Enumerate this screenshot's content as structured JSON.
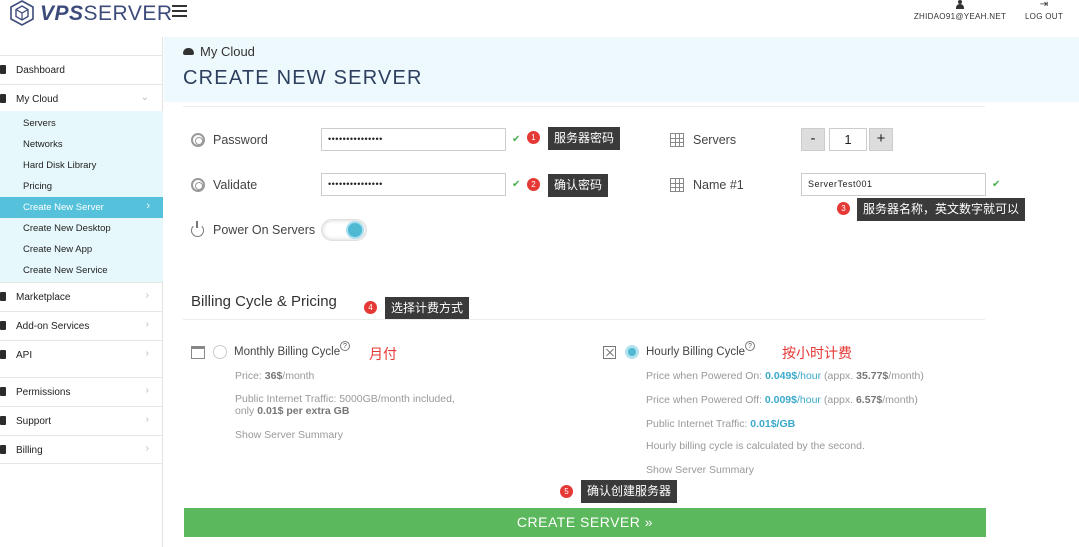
{
  "brand": {
    "logo_bold": "VPS",
    "logo_rest": "SERVER"
  },
  "header": {
    "user_email": "ZHIDAO91@YEAH.NET",
    "logout_label": "LOG OUT"
  },
  "sidebar": {
    "items": [
      {
        "label": "Dashboard"
      },
      {
        "label": "My Cloud"
      },
      {
        "label": "Marketplace"
      },
      {
        "label": "Add-on Services"
      },
      {
        "label": "API"
      },
      {
        "label": "Permissions"
      },
      {
        "label": "Support"
      },
      {
        "label": "Billing"
      }
    ],
    "sub_items": [
      {
        "label": "Servers"
      },
      {
        "label": "Networks"
      },
      {
        "label": "Hard Disk Library"
      },
      {
        "label": "Pricing"
      },
      {
        "label": "Create New Server"
      },
      {
        "label": "Create New Desktop"
      },
      {
        "label": "Create New App"
      },
      {
        "label": "Create New Service"
      }
    ]
  },
  "page": {
    "breadcrumb": "My Cloud",
    "title": "CREATE NEW SERVER"
  },
  "form": {
    "password_label": "Password",
    "password_value": "•••••••••••••••",
    "validate_label": "Validate",
    "validate_value": "•••••••••••••••",
    "servers_label": "Servers",
    "servers_count": "1",
    "minus_label": "-",
    "plus_label": "+",
    "name_label": "Name #1",
    "name_value": "ServerTest001",
    "power_label": "Power On Servers",
    "power_on": true
  },
  "annotations": [
    {
      "num": "1",
      "text": "服务器密码"
    },
    {
      "num": "2",
      "text": "确认密码"
    },
    {
      "num": "3",
      "text": "服务器名称，英文数字就可以"
    },
    {
      "num": "4",
      "text": "选择计费方式"
    },
    {
      "num": "5",
      "text": "确认创建服务器"
    }
  ],
  "notes": {
    "monthly": "月付",
    "hourly": "按小时计费"
  },
  "billing": {
    "section_title": "Billing Cycle & Pricing",
    "monthly": {
      "title": "Monthly Billing Cycle",
      "price_prefix": "Price: ",
      "price_value": "36$",
      "price_suffix": "/month",
      "traffic_line1": "Public Internet Traffic: 5000GB/month included,",
      "traffic_line2_prefix": "only ",
      "traffic_line2_bold": "0.01$ per extra GB",
      "summary_link": "Show Server Summary",
      "selected": false
    },
    "hourly": {
      "title": "Hourly Billing Cycle",
      "on_prefix": "Price when Powered On: ",
      "on_value": "0.049$",
      "on_unit": "/hour",
      "on_appx_prefix": " (appx. ",
      "on_appx_value": "35.77$",
      "on_appx_suffix": "/month)",
      "off_prefix": "Price when Powered Off: ",
      "off_value": "0.009$",
      "off_unit": "/hour",
      "off_appx_prefix": " (appx. ",
      "off_appx_value": "6.57$",
      "off_appx_suffix": "/month)",
      "traffic_prefix": "Public Internet Traffic: ",
      "traffic_value": "0.01$/GB",
      "note": "Hourly billing cycle is calculated by the second.",
      "summary_link": "Show Server Summary",
      "selected": true
    },
    "help_glyph": "?"
  },
  "create_button": {
    "label": "CREATE SERVER",
    "arrow": "»"
  },
  "colors": {
    "accent": "#55c1db",
    "button": "#5cb85c",
    "annotation_red": "#e53935",
    "title": "#2d3f5f"
  }
}
